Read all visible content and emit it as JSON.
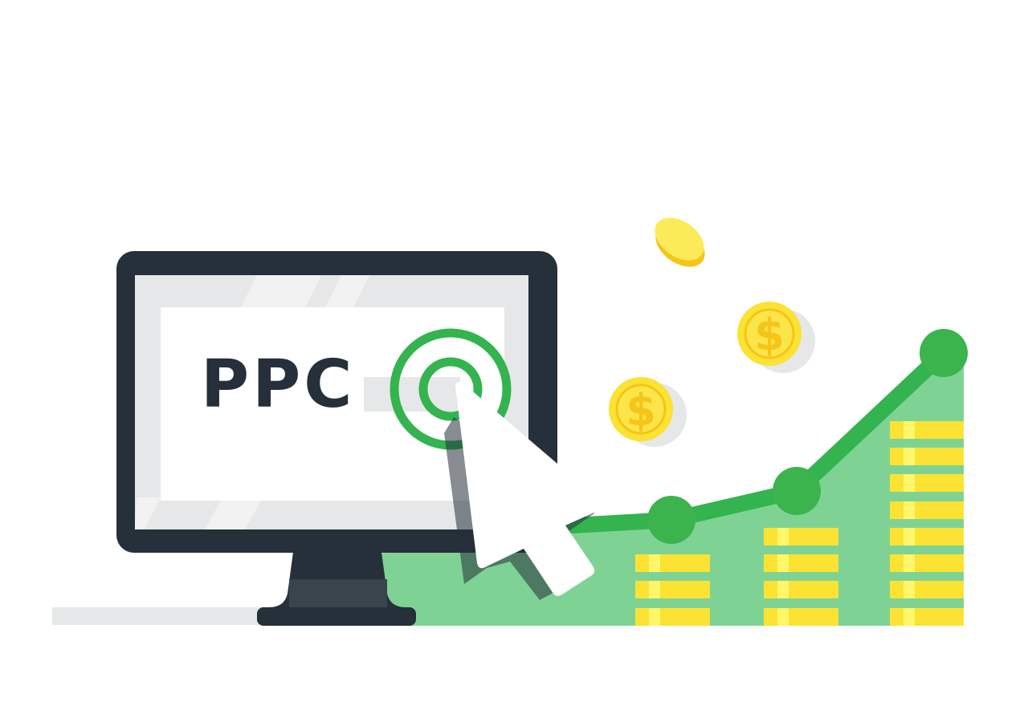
{
  "screen_text": "PPC",
  "coin_symbol": "$",
  "colors": {
    "monitor_frame": "#25303A",
    "screen_glass": "#E6E7E8",
    "screen_panel": "#FFFFFF",
    "green_primary": "#33B44E",
    "green_light": "#7ED394",
    "coin_yellow": "#FBE233",
    "coin_gold": "#F5C518",
    "text_dark": "#25303A"
  },
  "icons": [
    "monitor-icon",
    "target-icon",
    "cursor-arrow-icon",
    "coin-icon",
    "coin-stack-icon",
    "growth-line-icon"
  ]
}
